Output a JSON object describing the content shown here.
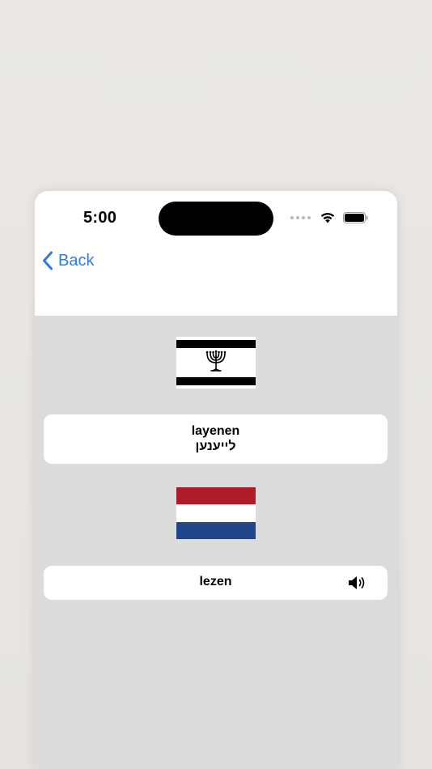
{
  "status_bar": {
    "time": "5:00"
  },
  "nav": {
    "back_label": "Back",
    "accent_color": "#2c7be5"
  },
  "cards": {
    "source": {
      "flag": "yiddish-flag-menorah",
      "transliteration": "layenen",
      "native": "לייענען"
    },
    "target": {
      "flag": "netherlands-flag",
      "word": "lezen",
      "audio_icon": "speaker-icon"
    }
  },
  "colors": {
    "content_bg": "#dcdcdc",
    "nl_red": "#ae1c28",
    "nl_white": "#ffffff",
    "nl_blue": "#21468b"
  }
}
